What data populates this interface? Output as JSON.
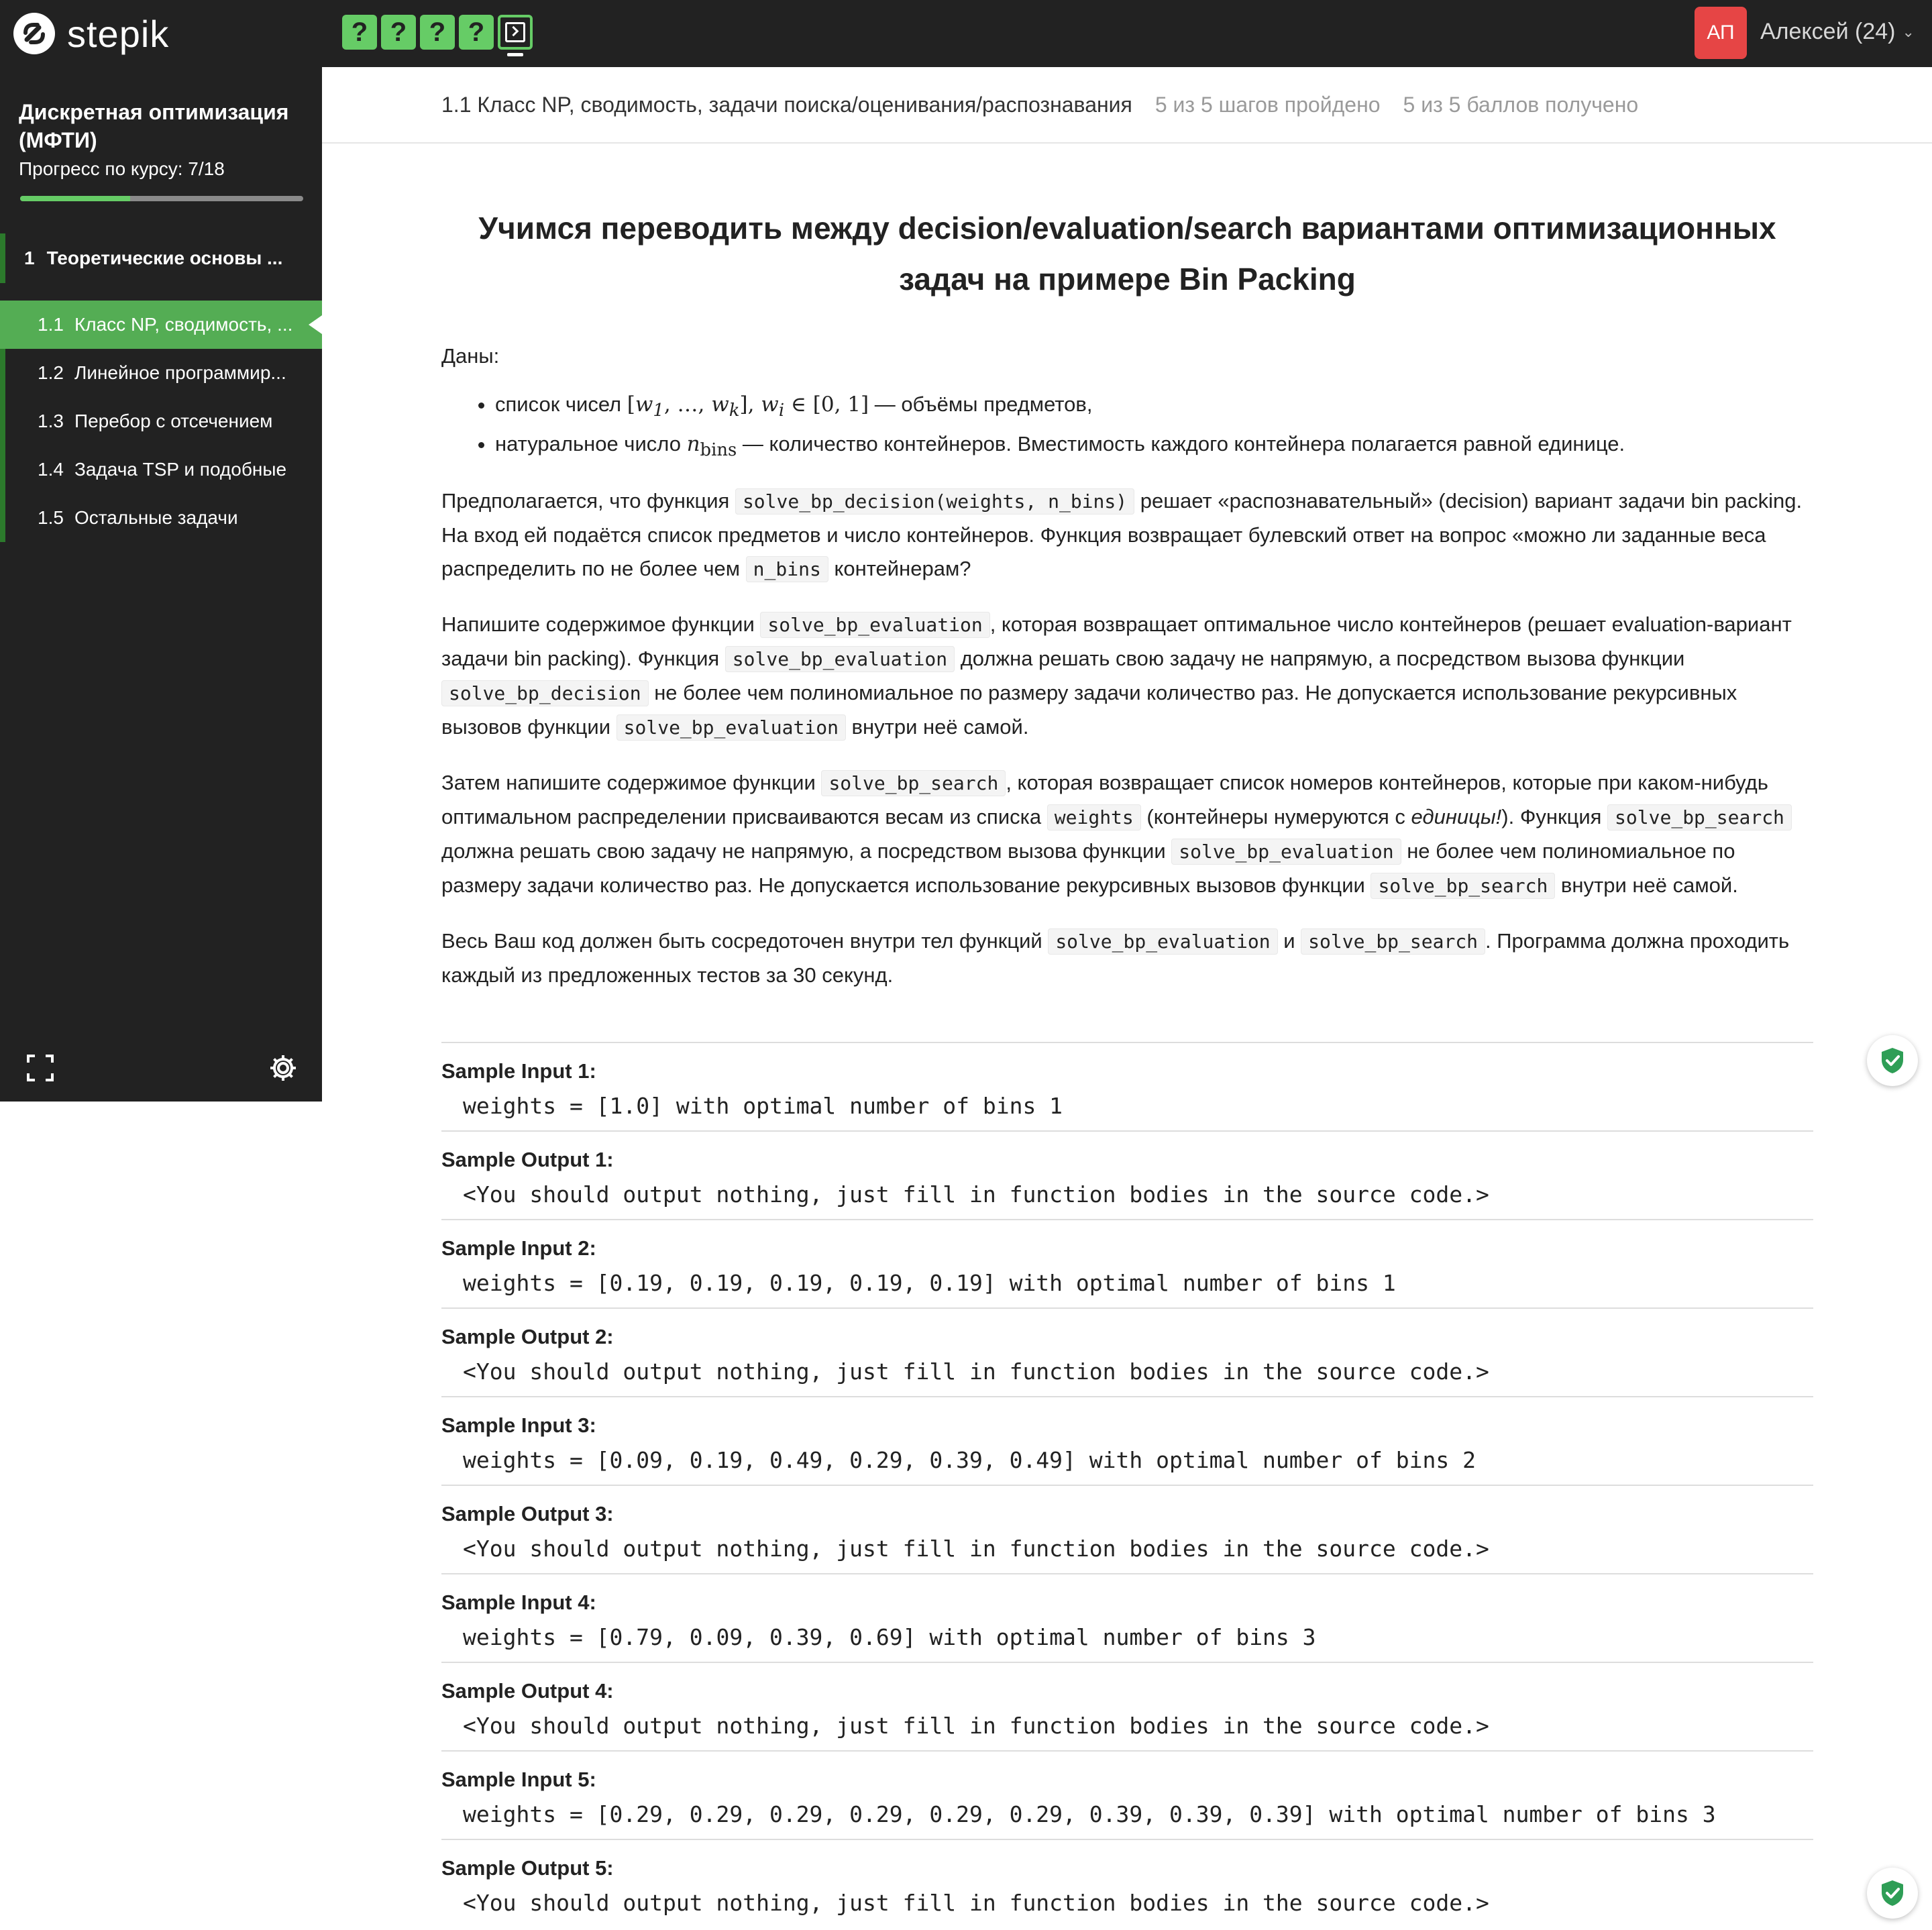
{
  "app": {
    "logo_text": "stepik",
    "step_buttons": [
      "?",
      "?",
      "?",
      "?"
    ],
    "current_step_icon": "terminal-icon",
    "avatar_initials": "АП",
    "user_name": "Алексей (24)",
    "colors": {
      "topbar": "#222222",
      "accent": "#66cc66",
      "avatar": "#e64545"
    }
  },
  "sidebar": {
    "course_title": "Дискретная оптимизация (МФТИ)",
    "progress_label": "Прогресс по курсу:  7/18",
    "progress": {
      "done": 7,
      "total": 18
    },
    "module": {
      "num": "1",
      "title": "Теоретические основы ..."
    },
    "lessons": [
      {
        "num": "1.1",
        "title": "Класс NP, сводимость, ..."
      },
      {
        "num": "1.2",
        "title": "Линейное программир..."
      },
      {
        "num": "1.3",
        "title": "Перебор с отсечением"
      },
      {
        "num": "1.4",
        "title": "Задача TSP и подобные"
      },
      {
        "num": "1.5",
        "title": "Остальные задачи"
      }
    ],
    "bottom_icons": [
      "expand-icon",
      "gear-icon"
    ]
  },
  "header": {
    "lesson_title": "1.1 Класс NP, сводимость, задачи поиска/оценивания/распознавания",
    "steps_status": "5 из 5 шагов пройдено",
    "points_status": "5 из 5 баллов  получено"
  },
  "content": {
    "title": "Учимся переводить между decision/evaluation/search вариантами оптимизационных задач на примере Bin Packing",
    "givens": "Даны:",
    "bullet1": {
      "prefix": "список чисел ",
      "suffix": " — объёмы предметов,"
    },
    "bullet2": {
      "prefix": "натуральное число ",
      "suffix": " — количество контейнеров. Вместимость каждого контейнера полагается равной единице."
    },
    "p1": {
      "t1": "Предполагается, что функция ",
      "c1": "solve_bp_decision(weights, n_bins)",
      "t2": " решает «распознавательный» (decision) вариант задачи bin packing. На вход ей подаётся список предметов и число контейнеров. Функция возвращает булевский ответ на вопрос «можно ли заданные веса распределить по не более чем ",
      "c2": "n_bins",
      "t3": " контейнерам?"
    },
    "p2": {
      "t1": "Напишите содержимое функции ",
      "c1": "solve_bp_evaluation",
      "t2": ", которая возвращает оптимальное число контейнеров (решает evaluation-вариант задачи bin packing). Функция ",
      "c2": "solve_bp_evaluation",
      "t3": " должна решать свою задачу не напрямую, а посредством вызова функции ",
      "c3": "solve_bp_decision",
      "t4": " не более чем полиномиальное по размеру задачи количество раз. Не допускается использование рекурсивных вызовов функции ",
      "c4": "solve_bp_evaluation",
      "t5": " внутри неё самой."
    },
    "p3": {
      "t1": "Затем напишите содержимое функции ",
      "c1": "solve_bp_search",
      "t2": ", которая возвращает список номеров контейнеров, которые при каком-нибудь оптимальном распределении присваиваются весам из списка ",
      "c2": "weights",
      "t3": " (контейнеры нумеруются с ",
      "em": "единицы!",
      "t4": "). Функция ",
      "c3": "solve_bp_search",
      "t5": " должна решать свою задачу не напрямую, а посредством вызова функции ",
      "c4": "solve_bp_evaluation",
      "t6": " не более чем полиномиальное по размеру задачи количество раз. Не допускается использование рекурсивных вызовов функции ",
      "c5": "solve_bp_search",
      "t7": " внутри неё самой."
    },
    "p4": {
      "t1": "Весь Ваш код должен быть сосредоточен внутри тел функций ",
      "c1": "solve_bp_evaluation",
      "t2": " и ",
      "c2": "solve_bp_search",
      "t3": ". Программа должна проходить каждый из предложенных тестов за 30 секунд."
    }
  },
  "samples": [
    {
      "label": "Sample Input 1:",
      "value": "weights = [1.0] with optimal number of bins 1"
    },
    {
      "label": "Sample Output 1:",
      "value": "<You should output nothing, just fill in function bodies in the source code.>"
    },
    {
      "label": "Sample Input 2:",
      "value": "weights = [0.19, 0.19, 0.19, 0.19, 0.19] with optimal number of bins 1"
    },
    {
      "label": "Sample Output 2:",
      "value": "<You should output nothing, just fill in function bodies in the source code.>"
    },
    {
      "label": "Sample Input 3:",
      "value": "weights = [0.09, 0.19, 0.49, 0.29, 0.39, 0.49] with optimal number of bins 2"
    },
    {
      "label": "Sample Output 3:",
      "value": "<You should output nothing, just fill in function bodies in the source code.>"
    },
    {
      "label": "Sample Input 4:",
      "value": "weights = [0.79, 0.09, 0.39, 0.69] with optimal number of bins 3"
    },
    {
      "label": "Sample Output 4:",
      "value": "<You should output nothing, just fill in function bodies in the source code.>"
    },
    {
      "label": "Sample Input 5:",
      "value": "weights = [0.29, 0.29, 0.29, 0.29, 0.29, 0.29, 0.39, 0.39, 0.39] with optimal number of bins 3"
    },
    {
      "label": "Sample Output 5:",
      "value": "<You should output nothing, just fill in function bodies in the source code.>"
    }
  ],
  "floating_buttons": [
    "shield-check-icon",
    "shield-check-icon"
  ]
}
